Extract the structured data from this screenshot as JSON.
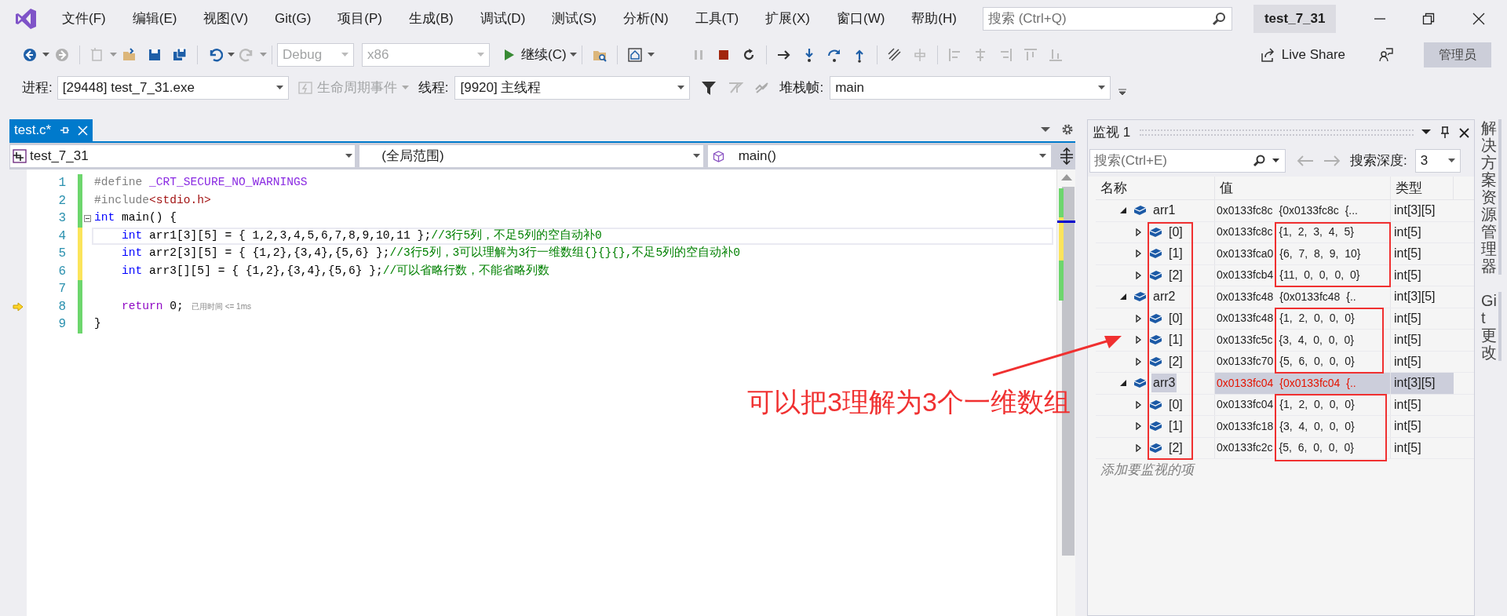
{
  "title_bar": {
    "menu": [
      "文件(F)",
      "编辑(E)",
      "视图(V)",
      "Git(G)",
      "项目(P)",
      "生成(B)",
      "调试(D)",
      "测试(S)",
      "分析(N)",
      "工具(T)",
      "扩展(X)",
      "窗口(W)",
      "帮助(H)"
    ],
    "search": {
      "placeholder": "搜索 (Ctrl+Q)"
    },
    "solution_name": "test_7_31"
  },
  "toolbar": {
    "configuration": {
      "value": "Debug",
      "disabled": true
    },
    "platform": {
      "value": "x86",
      "disabled": true
    },
    "continue_label": "继续(C)",
    "live_share": "Live Share",
    "admin_badge": "管理员"
  },
  "debug_location": {
    "process_label": "进程:",
    "process": "[29448] test_7_31.exe",
    "lifecycle": {
      "label": "生命周期事件",
      "disabled": true
    },
    "thread_label": "线程:",
    "thread": "[9920] 主线程",
    "stack_frame_label": "堆栈帧:",
    "stack_frame": "main"
  },
  "editor": {
    "tabs": [
      {
        "label": "test.c*",
        "selected": true
      }
    ],
    "nav": {
      "project": "test_7_31",
      "scope": "(全局范围)",
      "member": "main()"
    },
    "lines": [
      {
        "number": "1",
        "kind": "code",
        "unsaved": false,
        "tokens": [
          {
            "kind": "preprocessor",
            "text": "#define "
          },
          {
            "kind": "macro",
            "text": "_CRT_SECURE_NO_WARNINGS"
          }
        ]
      },
      {
        "number": "2",
        "kind": "code",
        "unsaved": false,
        "tokens": [
          {
            "kind": "preprocessor",
            "text": "#include"
          },
          {
            "kind": "string",
            "text": "<stdio.h>"
          }
        ]
      },
      {
        "number": "3",
        "kind": "fold_start",
        "unsaved": false,
        "tokens": [
          {
            "kind": "keyword",
            "text": "int"
          },
          {
            "kind": "plain",
            "text": " main() {"
          }
        ]
      },
      {
        "number": "4",
        "kind": "current",
        "unsaved": true,
        "tokens": [
          {
            "kind": "keyword",
            "text": "    int"
          },
          {
            "kind": "plain",
            "text": " arr1[3][5] = { 1,2,3,4,5,6,7,8,9,10,11 };"
          },
          {
            "kind": "comment",
            "text": "//3行5列，不足5列的空自动补0"
          }
        ]
      },
      {
        "number": "5",
        "kind": "code",
        "unsaved": true,
        "tokens": [
          {
            "kind": "keyword",
            "text": "    int"
          },
          {
            "kind": "plain",
            "text": " arr2[3][5] = { {1,2},{3,4},{5,6} };"
          },
          {
            "kind": "comment",
            "text": "//3行5列，3可以理解为3行一维数组{}{}{},不足5列的空自动补0"
          }
        ]
      },
      {
        "number": "6",
        "kind": "code",
        "unsaved": true,
        "tokens": [
          {
            "kind": "keyword",
            "text": "    int"
          },
          {
            "kind": "plain",
            "text": " arr3[][5] = { {1,2},{3,4},{5,6} };"
          },
          {
            "kind": "comment",
            "text": "//可以省略行数，不能省略列数"
          }
        ]
      },
      {
        "number": "7",
        "kind": "code",
        "unsaved": false
      },
      {
        "number": "8",
        "kind": "next_statement",
        "unsaved": false,
        "tokens": [
          {
            "kind": "control",
            "text": "    return"
          },
          {
            "kind": "plain",
            "text": " 0;"
          }
        ],
        "hint": "已用时间 <= 1ms"
      },
      {
        "number": "9",
        "kind": "code",
        "unsaved": false,
        "tokens": [
          {
            "kind": "plain",
            "text": "}"
          }
        ]
      }
    ]
  },
  "watch": {
    "title": "监视 1",
    "search": {
      "placeholder": "搜索(Ctrl+E)"
    },
    "depth_label": "搜索深度:",
    "depth": "3",
    "columns": [
      "名称",
      "值",
      "类型"
    ],
    "rows": [
      {
        "name": "arr1",
        "value": "0x0133fc8c {0x0133fc8c {...",
        "type": "int[3][5]",
        "expanded": true,
        "selected": false,
        "changed": false,
        "children": [
          {
            "name": "[0]",
            "value": "0x0133fc8c {1, 2, 3, 4, 5}",
            "type": "int[5]",
            "expanded": false,
            "selected": false,
            "changed": false
          },
          {
            "name": "[1]",
            "value": "0x0133fca0 {6, 7, 8, 9, 10}",
            "type": "int[5]",
            "expanded": false,
            "selected": false,
            "changed": false
          },
          {
            "name": "[2]",
            "value": "0x0133fcb4 {11, 0, 0, 0, 0}",
            "type": "int[5]",
            "expanded": false,
            "selected": false,
            "changed": false
          }
        ]
      },
      {
        "name": "arr2",
        "value": "0x0133fc48 {0x0133fc48 {..",
        "type": "int[3][5]",
        "expanded": true,
        "selected": false,
        "changed": false,
        "children": [
          {
            "name": "[0]",
            "value": "0x0133fc48 {1, 2, 0, 0, 0}",
            "type": "int[5]",
            "expanded": false,
            "selected": false,
            "changed": false
          },
          {
            "name": "[1]",
            "value": "0x0133fc5c {3, 4, 0, 0, 0}",
            "type": "int[5]",
            "expanded": false,
            "selected": false,
            "changed": false
          },
          {
            "name": "[2]",
            "value": "0x0133fc70 {5, 6, 0, 0, 0}",
            "type": "int[5]",
            "expanded": false,
            "selected": false,
            "changed": false
          }
        ]
      },
      {
        "name": "arr3",
        "value": "0x0133fc04 {0x0133fc04 {..",
        "type": "int[3][5]",
        "expanded": true,
        "selected": true,
        "changed": true,
        "children": [
          {
            "name": "[0]",
            "value": "0x0133fc04 {1, 2, 0, 0, 0}",
            "type": "int[5]",
            "expanded": false,
            "selected": false,
            "changed": false
          },
          {
            "name": "[1]",
            "value": "0x0133fc18 {3, 4, 0, 0, 0}",
            "type": "int[5]",
            "expanded": false,
            "selected": false,
            "changed": false
          },
          {
            "name": "[2]",
            "value": "0x0133fc2c {5, 6, 0, 0, 0}",
            "type": "int[5]",
            "expanded": false,
            "selected": false,
            "changed": false
          }
        ]
      }
    ],
    "add_placeholder": "添加要监视的项"
  },
  "side_tabs": [
    "解决方案资源管理器",
    "Git 更改"
  ],
  "annotation": {
    "text": "可以把3理解为3个一维数组"
  }
}
